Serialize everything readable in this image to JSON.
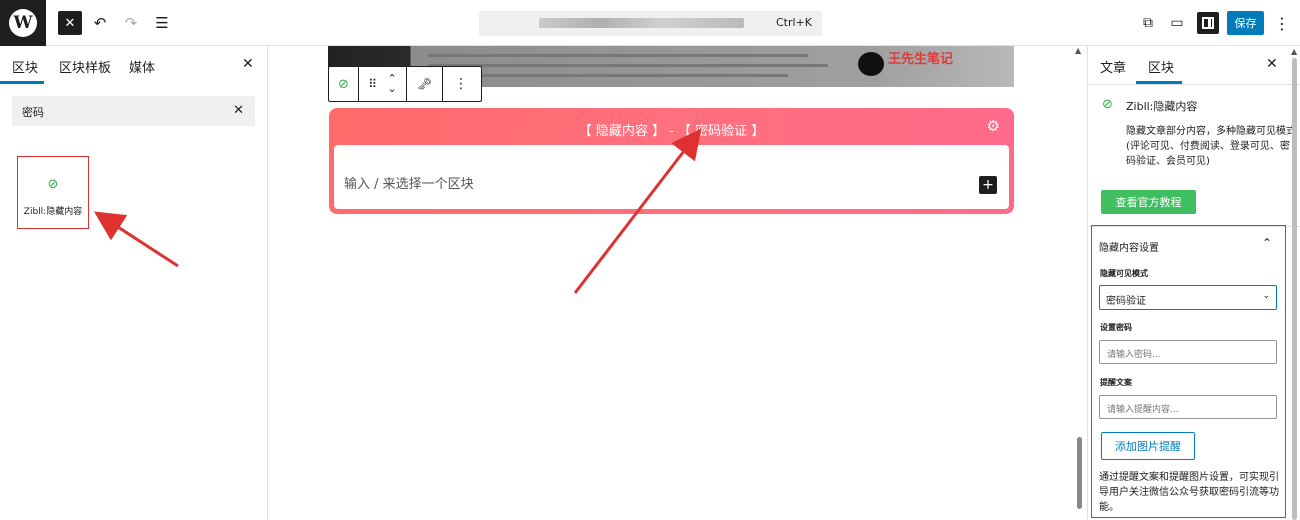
{
  "topbar": {
    "close_glyph": "✕",
    "undo_glyph": "↶",
    "redo_glyph": "↷",
    "outline_glyph": "☰",
    "command_shortcut": "Ctrl+K",
    "save_label": "保存",
    "external_glyph": "⧉",
    "laptop_glyph": "▭",
    "more_glyph": "⋮"
  },
  "left_panel": {
    "tabs": [
      "区块",
      "区块样板",
      "媒体"
    ],
    "active_tab": "区块",
    "close_glyph": "✕",
    "search_value": "密码",
    "search_clear": "✕",
    "results": [
      {
        "label": "Zibll:隐藏内容",
        "icon": "eye-slash-icon",
        "icon_glyph": "⊘"
      }
    ]
  },
  "block_toolbar": {
    "eye_glyph": "⊘",
    "drag_glyph": "⠿",
    "up_glyph": "⌃",
    "down_glyph": "⌄",
    "lock_glyph": "🗝",
    "more_glyph": "⋮"
  },
  "hidden_block": {
    "title": "【 隐藏内容 】 - 【 密码验证 】",
    "gear_glyph": "⚙",
    "placeholder": "输入 / 来选择一个区块",
    "plus_glyph": "+"
  },
  "image_watermark": "王先生笔记",
  "right_panel": {
    "tabs": [
      "文章",
      "区块"
    ],
    "active_tab": "区块",
    "close_glyph": "✕",
    "block_icon_glyph": "⊘",
    "block_title": "Zibll:隐藏内容",
    "block_description": "隐藏文章部分内容，多种隐藏可见模式(评论可见、付费阅读、登录可见、密码验证、会员可见)",
    "tutorial_button": "查看官方教程",
    "settings": {
      "section_title": "隐藏内容设置",
      "chevron": "⌃",
      "mode_label": "隐藏可见模式",
      "mode_value": "密码验证",
      "mode_caret": "⌄",
      "password_label": "设置密码",
      "password_placeholder": "请输入密码...",
      "tip_label": "提醒文案",
      "tip_placeholder": "请输入提醒内容...",
      "add_image_button": "添加图片提醒",
      "help_text": "通过提醒文案和提醒图片设置，可实现引导用户关注微信公众号获取密码引流等功能。"
    }
  },
  "colors": {
    "accent": "#007cba",
    "highlight": "#e03131",
    "block_gradient_start": "#ff6a6a",
    "icon_green": "#2fae4d",
    "tutorial_green": "#3fbf5f"
  }
}
